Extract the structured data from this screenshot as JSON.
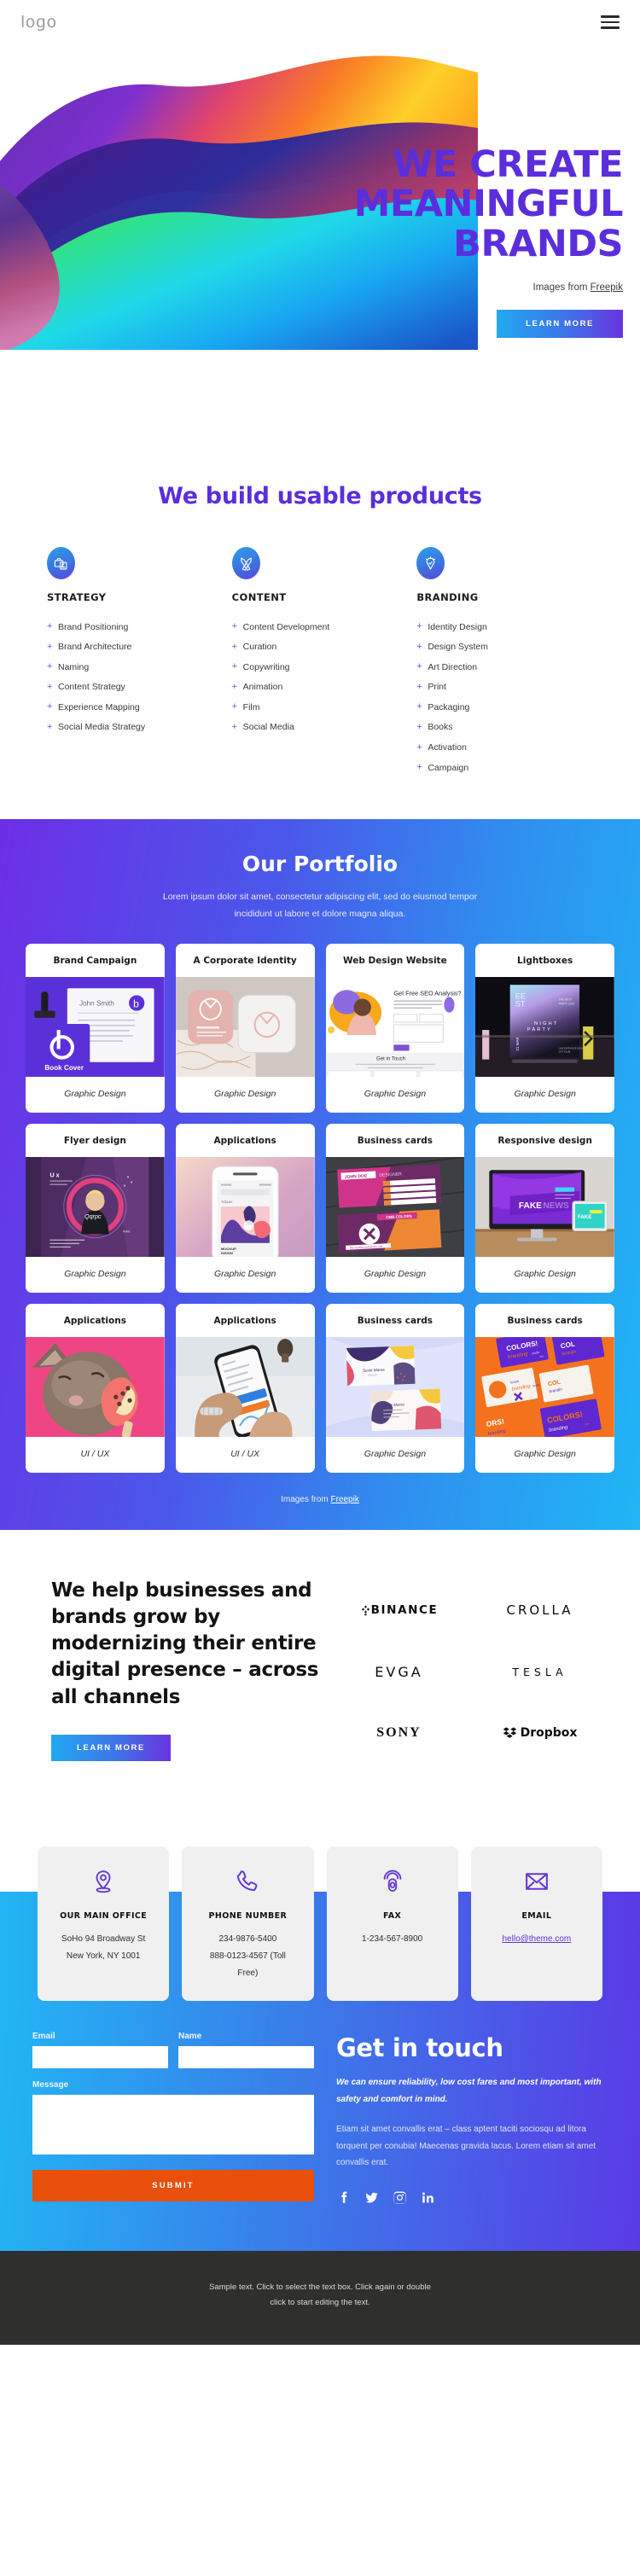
{
  "header": {
    "logo": "logo",
    "menu_icon": "hamburger-menu-icon"
  },
  "hero": {
    "title_line1": "WE CREATE",
    "title_line2": "MEANINGFUL",
    "title_line3": "BRANDS",
    "credit_prefix": "Images from ",
    "credit_link": "Freepik",
    "cta": "LEARN MORE",
    "accent_color": "#5b2edc"
  },
  "services": {
    "title": "We build usable products",
    "columns": [
      {
        "icon": "briefcase-checklist-icon",
        "heading": "STRATEGY",
        "items": [
          "Brand Positioning",
          "Brand Architecture",
          "Naming",
          "Content Strategy",
          "Experience Mapping",
          "Social Media Strategy"
        ]
      },
      {
        "icon": "pencil-ruler-icon",
        "heading": "CONTENT",
        "items": [
          "Content Development",
          "Curation",
          "Copywriting",
          "Animation",
          "Film",
          "Social Media"
        ]
      },
      {
        "icon": "lightbulb-pin-icon",
        "heading": "BRANDING",
        "items": [
          "Identity Design",
          "Design System",
          "Art Direction",
          "Print",
          "Packaging",
          "Books",
          "Activation",
          "Campaign"
        ]
      }
    ]
  },
  "portfolio": {
    "title": "Our Portfolio",
    "subtitle": "Lorem ipsum dolor sit amet, consectetur adipiscing elit, sed do eiusmod tempor incididunt ut labore et dolore magna aliqua.",
    "credit_prefix": "Images from ",
    "credit_link": "Freepik",
    "cards": [
      {
        "title": "Brand Campaign",
        "category": "Graphic Design",
        "thumb": "brand-campaign-stationery"
      },
      {
        "title": "A Corporate Identity",
        "category": "Graphic Design",
        "thumb": "corporate-identity-marble"
      },
      {
        "title": "Web Design Website",
        "category": "Graphic Design",
        "thumb": "web-design-landing-page"
      },
      {
        "title": "Lightboxes",
        "category": "Graphic Design",
        "thumb": "lightbox-night-party-poster"
      },
      {
        "title": "Flyer design",
        "category": "Graphic Design",
        "thumb": "purple-flyer-ux"
      },
      {
        "title": "Applications",
        "category": "Graphic Design",
        "thumb": "phone-mockup-design"
      },
      {
        "title": "Business cards",
        "category": "Graphic Design",
        "thumb": "pink-business-cards"
      },
      {
        "title": "Responsive design",
        "category": "Graphic Design",
        "thumb": "imac-fake-news"
      },
      {
        "title": "Applications",
        "category": "UI / UX",
        "thumb": "cat-with-popsicle"
      },
      {
        "title": "Applications",
        "category": "UI / UX",
        "thumb": "hands-holding-phone"
      },
      {
        "title": "Business cards",
        "category": "Graphic Design",
        "thumb": "pastel-business-cards"
      },
      {
        "title": "Business cards",
        "category": "Graphic Design",
        "thumb": "orange-colors-branding"
      }
    ]
  },
  "about": {
    "heading": "We help businesses and brands grow by modernizing their entire digital presence – across all channels",
    "cta": "LEARN MORE",
    "brands": [
      {
        "name": "BINANCE",
        "icon": "binance-diamond-icon"
      },
      {
        "name": "CROLLA",
        "icon": ""
      },
      {
        "name": "EVGA",
        "icon": ""
      },
      {
        "name": "TESLA",
        "icon": ""
      },
      {
        "name": "SONY",
        "icon": ""
      },
      {
        "name": "Dropbox",
        "icon": "dropbox-icon"
      }
    ]
  },
  "contact_cards": [
    {
      "icon": "map-pin-icon",
      "title": "OUR MAIN OFFICE",
      "line1": "SoHo 94 Broadway St",
      "line2": "New York, NY 1001",
      "line3": "",
      "link": ""
    },
    {
      "icon": "phone-icon",
      "title": "PHONE NUMBER",
      "line1": "234-9876-5400",
      "line2": "888-0123-4567 (Toll",
      "line3": "Free)",
      "link": ""
    },
    {
      "icon": "fax-icon",
      "title": "FAX",
      "line1": "1-234-567-8900",
      "line2": "",
      "line3": "",
      "link": ""
    },
    {
      "icon": "envelope-icon",
      "title": "EMAIL",
      "line1": "",
      "line2": "",
      "line3": "",
      "link": "hello@theme.com"
    }
  ],
  "touch": {
    "title": "Get in touch",
    "lead": "We can ensure reliability, low cost fares and most important, with safety and comfort in mind.",
    "body": "Etiam sit amet convallis erat – class aptent taciti sociosqu ad litora torquent per conubia! Maecenas gravida lacus. Lorem etiam sit amet convallis erat.",
    "form": {
      "email_label": "Email",
      "email_value": "",
      "name_label": "Name",
      "name_value": "",
      "message_label": "Message",
      "message_value": "",
      "submit": "SUBMIT"
    },
    "socials": [
      "facebook-icon",
      "twitter-icon",
      "instagram-icon",
      "linkedin-icon"
    ]
  },
  "footer": {
    "line1": "Sample text. Click to select the text box. Click again or double",
    "line2": "click to start editing the text."
  }
}
